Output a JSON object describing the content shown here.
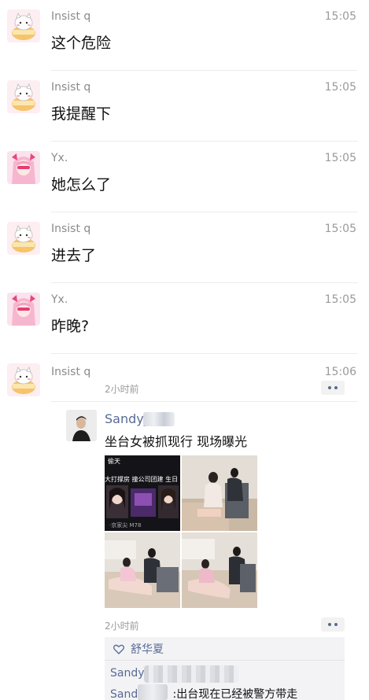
{
  "messages": [
    {
      "name": "Insist q",
      "time": "15:05",
      "text": "这个危险"
    },
    {
      "name": "Insist q",
      "time": "15:05",
      "text": "我提醒下"
    },
    {
      "name": "Yx.",
      "time": "15:05",
      "text": "她怎么了"
    },
    {
      "name": "Insist q",
      "time": "15:05",
      "text": "进去了"
    },
    {
      "name": "Yx.",
      "time": "15:05",
      "text": "昨晚?"
    }
  ],
  "shared_message": {
    "name": "Insist q",
    "time": "15:06",
    "time_ago": "2小时前",
    "moment": {
      "author": "Sandy_",
      "text": "坐台女被抓现行 现场曝光",
      "photo1": {
        "title": "偷天",
        "tags": "大打撑房 撞公司团建 生日",
        "caption": "·京家尖 M78"
      },
      "time_ago": "2小时前",
      "likes": "舒华夏",
      "comment1_name": "Sandy",
      "comment2_name": "Sandy",
      "comment2_text": ":出台现在已经被警方带走"
    }
  },
  "colors": {
    "link": "#576b95",
    "meta": "#9a9a9a"
  }
}
